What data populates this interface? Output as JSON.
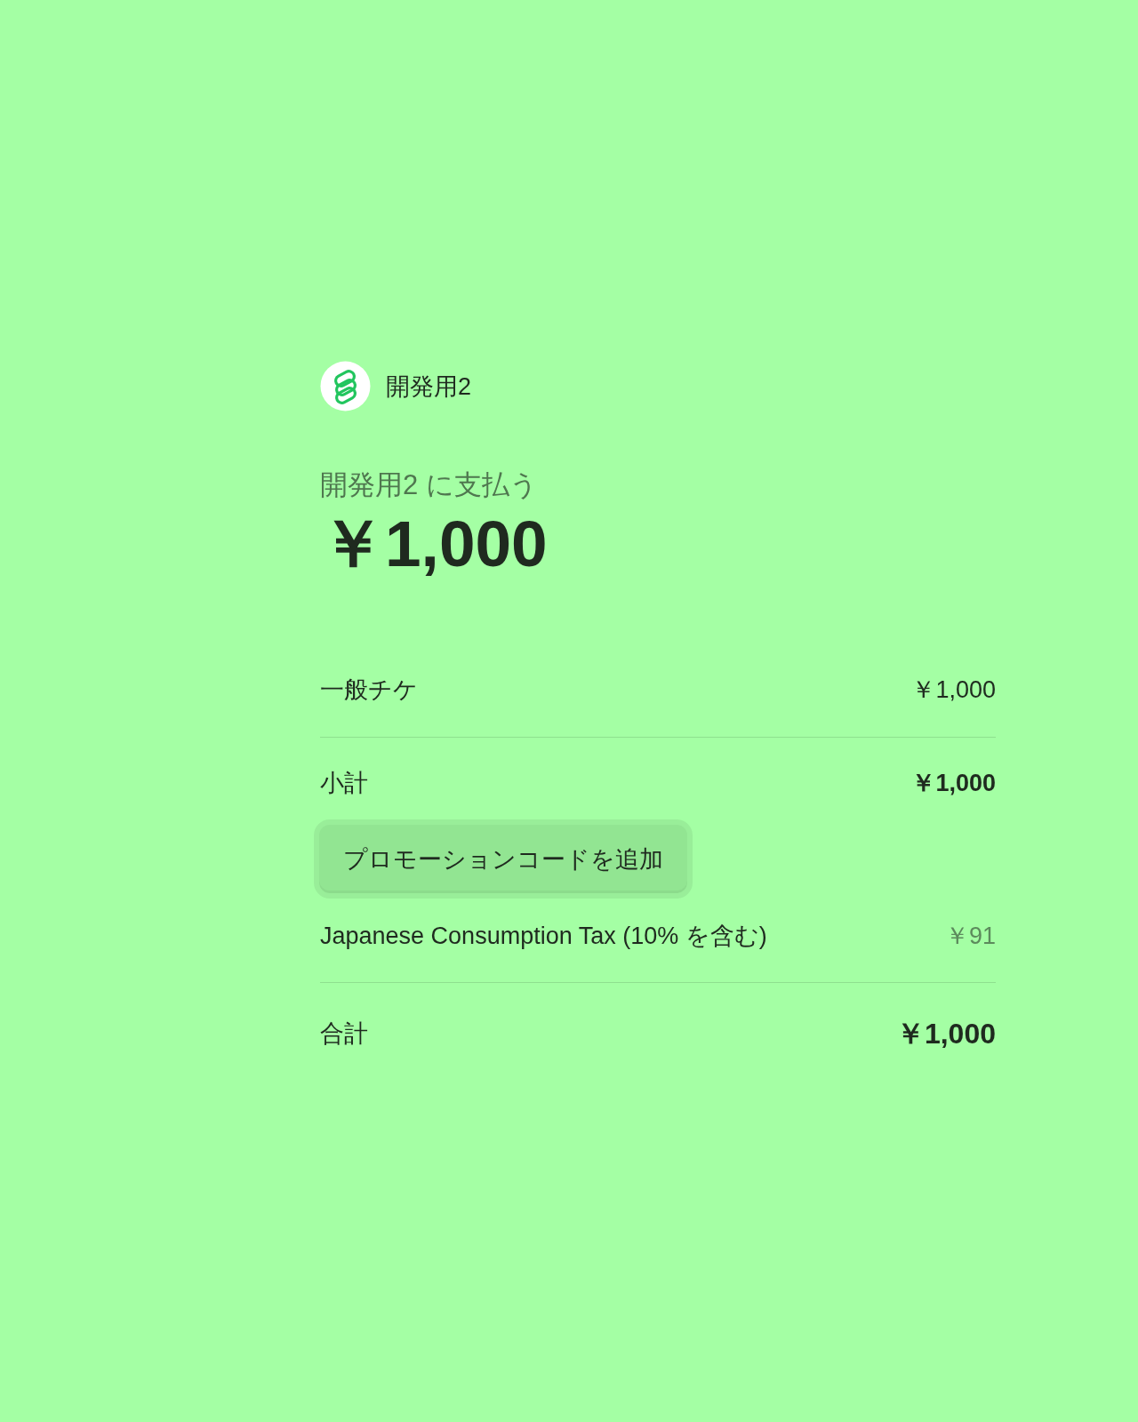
{
  "merchant": {
    "name": "開発用2"
  },
  "summary": {
    "pay_to": "開発用2 に支払う",
    "amount": "￥1,000"
  },
  "line_items": [
    {
      "name": "一般チケ",
      "amount": "￥1,000"
    }
  ],
  "subtotal": {
    "label": "小計",
    "amount": "￥1,000"
  },
  "promo_button": {
    "label": "プロモーションコードを追加"
  },
  "tax": {
    "label": "Japanese Consumption Tax (10% を含む)",
    "amount": "￥91"
  },
  "total": {
    "label": "合計",
    "amount": "￥1,000"
  }
}
